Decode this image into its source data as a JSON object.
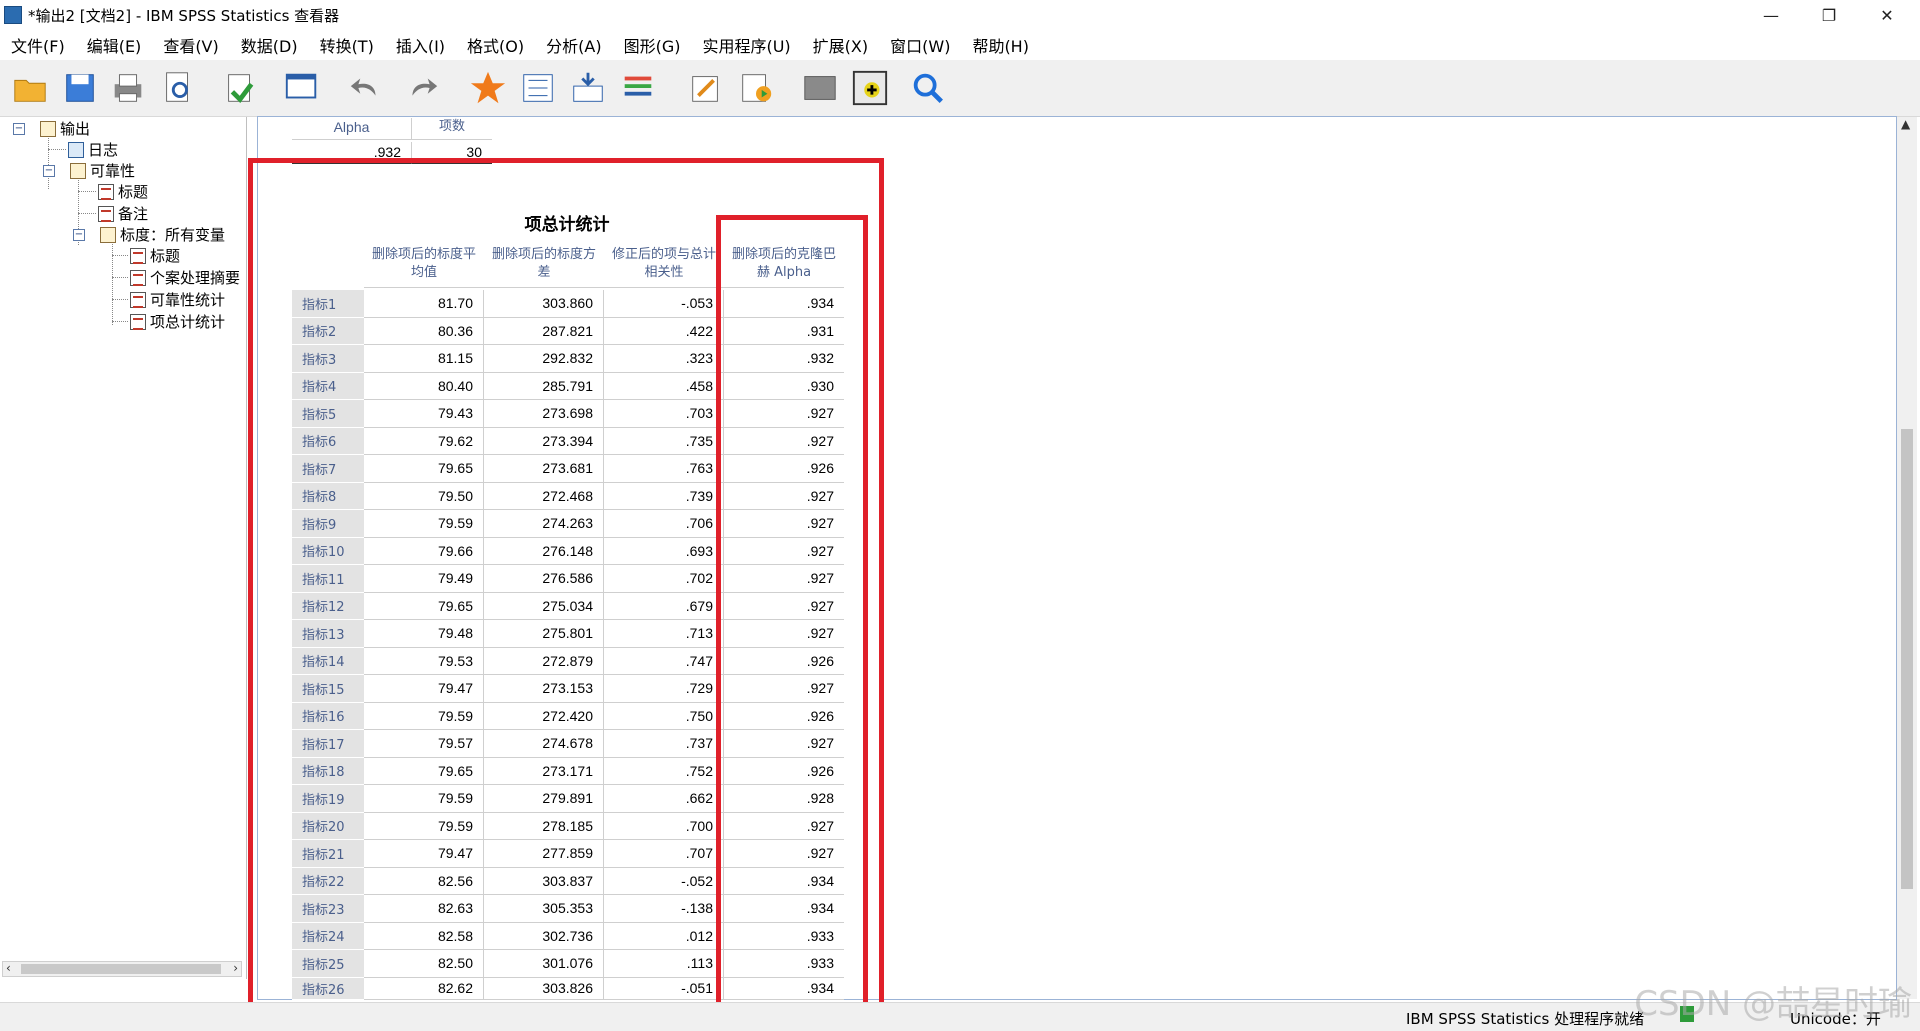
{
  "window": {
    "title": "*输出2 [文档2] - IBM SPSS Statistics 查看器",
    "controls": {
      "minimize": "—",
      "restore": "❐",
      "close": "✕"
    }
  },
  "menu": [
    "文件(F)",
    "编辑(E)",
    "查看(V)",
    "数据(D)",
    "转换(T)",
    "插入(I)",
    "格式(O)",
    "分析(A)",
    "图形(G)",
    "实用程序(U)",
    "扩展(X)",
    "窗口(W)",
    "帮助(H)"
  ],
  "toolbar": {
    "icons": [
      "open-folder-icon",
      "save-icon",
      "print-icon",
      "print-preview-icon",
      "export-icon",
      "recall-dialog-icon",
      "undo-icon",
      "redo-icon",
      "goto-case-icon",
      "goto-variable-icon",
      "insert-cases-icon",
      "variables-icon",
      "edit-icon",
      "run-icon",
      "hidden-icon",
      "designate-window-icon",
      "find-icon"
    ]
  },
  "tree": {
    "root": "输出",
    "log": "日志",
    "reliability": "可靠性",
    "title": "标题",
    "notes": "备注",
    "scale": "标度：所有变量",
    "scale_title": "标题",
    "case_summary": "个案处理摘要",
    "reliability_stats": "可靠性统计",
    "item_total": "项总计统计"
  },
  "reliability_table": {
    "headers": [
      "Alpha",
      "项数"
    ],
    "values": [
      ".932",
      "30"
    ]
  },
  "item_total_table": {
    "title": "项总计统计",
    "columns": [
      "删除项后的标度平均值",
      "删除项后的标度方差",
      "修正后的项与总计相关性",
      "删除项后的克隆巴赫 Alpha"
    ],
    "rows": [
      {
        "label": "指标1",
        "values": [
          "81.70",
          "303.860",
          "-.053",
          ".934"
        ]
      },
      {
        "label": "指标2",
        "values": [
          "80.36",
          "287.821",
          ".422",
          ".931"
        ]
      },
      {
        "label": "指标3",
        "values": [
          "81.15",
          "292.832",
          ".323",
          ".932"
        ]
      },
      {
        "label": "指标4",
        "values": [
          "80.40",
          "285.791",
          ".458",
          ".930"
        ]
      },
      {
        "label": "指标5",
        "values": [
          "79.43",
          "273.698",
          ".703",
          ".927"
        ]
      },
      {
        "label": "指标6",
        "values": [
          "79.62",
          "273.394",
          ".735",
          ".927"
        ]
      },
      {
        "label": "指标7",
        "values": [
          "79.65",
          "273.681",
          ".763",
          ".926"
        ]
      },
      {
        "label": "指标8",
        "values": [
          "79.50",
          "272.468",
          ".739",
          ".927"
        ]
      },
      {
        "label": "指标9",
        "values": [
          "79.59",
          "274.263",
          ".706",
          ".927"
        ]
      },
      {
        "label": "指标10",
        "values": [
          "79.66",
          "276.148",
          ".693",
          ".927"
        ]
      },
      {
        "label": "指标11",
        "values": [
          "79.49",
          "276.586",
          ".702",
          ".927"
        ]
      },
      {
        "label": "指标12",
        "values": [
          "79.65",
          "275.034",
          ".679",
          ".927"
        ]
      },
      {
        "label": "指标13",
        "values": [
          "79.48",
          "275.801",
          ".713",
          ".927"
        ]
      },
      {
        "label": "指标14",
        "values": [
          "79.53",
          "272.879",
          ".747",
          ".926"
        ]
      },
      {
        "label": "指标15",
        "values": [
          "79.47",
          "273.153",
          ".729",
          ".927"
        ]
      },
      {
        "label": "指标16",
        "values": [
          "79.59",
          "272.420",
          ".750",
          ".926"
        ]
      },
      {
        "label": "指标17",
        "values": [
          "79.57",
          "274.678",
          ".737",
          ".927"
        ]
      },
      {
        "label": "指标18",
        "values": [
          "79.65",
          "273.171",
          ".752",
          ".926"
        ]
      },
      {
        "label": "指标19",
        "values": [
          "79.59",
          "279.891",
          ".662",
          ".928"
        ]
      },
      {
        "label": "指标20",
        "values": [
          "79.59",
          "278.185",
          ".700",
          ".927"
        ]
      },
      {
        "label": "指标21",
        "values": [
          "79.47",
          "277.859",
          ".707",
          ".927"
        ]
      },
      {
        "label": "指标22",
        "values": [
          "82.56",
          "303.837",
          "-.052",
          ".934"
        ]
      },
      {
        "label": "指标23",
        "values": [
          "82.63",
          "305.353",
          "-.138",
          ".934"
        ]
      },
      {
        "label": "指标24",
        "values": [
          "82.58",
          "302.736",
          ".012",
          ".933"
        ]
      },
      {
        "label": "指标25",
        "values": [
          "82.50",
          "301.076",
          ".113",
          ".933"
        ]
      },
      {
        "label": "指标26",
        "values": [
          "82.62",
          "303.826",
          "-.051",
          ".934"
        ]
      }
    ]
  },
  "status": {
    "processor": "IBM SPSS Statistics 处理程序就绪",
    "unicode": "Unicode：开"
  },
  "watermark": "CSDN @喆星时瑜",
  "colors": {
    "highlight": "#e0202a",
    "header_text": "#4a5f8c"
  }
}
